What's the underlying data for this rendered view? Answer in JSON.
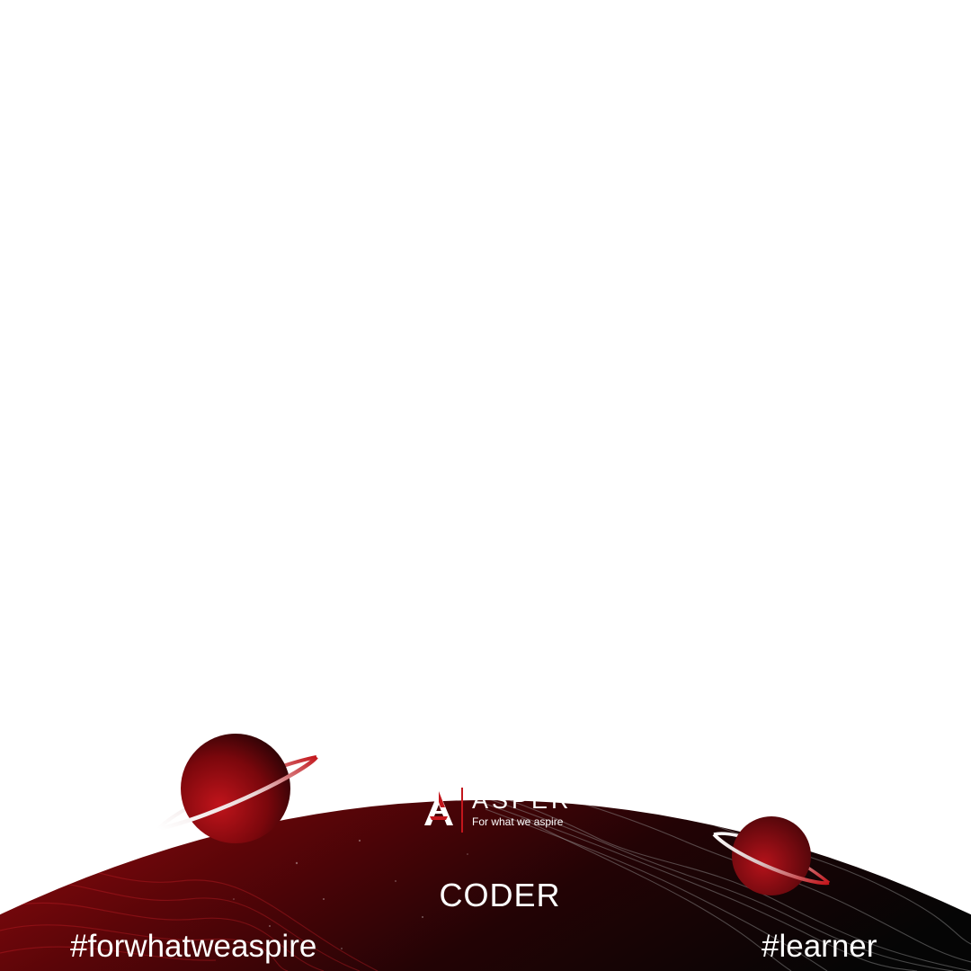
{
  "brand": {
    "name": "ASPER",
    "tagline": "For what we aspire"
  },
  "role": {
    "label": "CODER"
  },
  "hashtags": {
    "left": "#forwhatweaspire",
    "right": "#learner"
  },
  "colors": {
    "background": "#ffffff",
    "accent_red": "#c3161c",
    "deep_red": "#8a0a0f",
    "dark": "#0b0b0b",
    "text": "#ffffff"
  },
  "icons": [
    "asper-logo-icon",
    "ringed-planet-icon",
    "ringed-planet-icon"
  ]
}
